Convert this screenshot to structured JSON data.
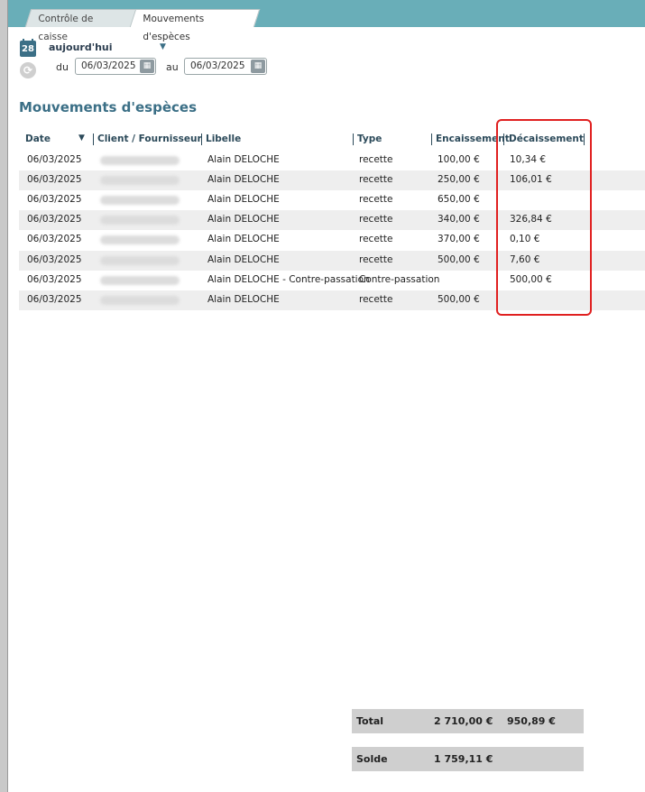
{
  "tabs": [
    {
      "label": "Contrôle de caisse"
    },
    {
      "label": "Mouvements d'espèces"
    }
  ],
  "filter": {
    "calendar_day": "28",
    "period": "aujourd'hui",
    "from_label": "du",
    "from_date": "06/03/2025",
    "to_label": "au",
    "to_date": "06/03/2025"
  },
  "section_title": "Mouvements d'espèces",
  "table": {
    "columns": [
      "Date",
      "Client / Fournisseur",
      "Libelle",
      "Type",
      "Encaissement",
      "Décaissement"
    ],
    "rows": [
      {
        "date": "06/03/2025",
        "libelle": "Alain DELOCHE",
        "type": "recette",
        "encaissement": "100,00 €",
        "decaissement": "10,34 €"
      },
      {
        "date": "06/03/2025",
        "libelle": "Alain DELOCHE",
        "type": "recette",
        "encaissement": "250,00 €",
        "decaissement": "106,01 €"
      },
      {
        "date": "06/03/2025",
        "libelle": "Alain DELOCHE",
        "type": "recette",
        "encaissement": "650,00 €",
        "decaissement": ""
      },
      {
        "date": "06/03/2025",
        "libelle": "Alain DELOCHE",
        "type": "recette",
        "encaissement": "340,00 €",
        "decaissement": "326,84 €"
      },
      {
        "date": "06/03/2025",
        "libelle": "Alain DELOCHE",
        "type": "recette",
        "encaissement": "370,00 €",
        "decaissement": "0,10 €"
      },
      {
        "date": "06/03/2025",
        "libelle": "Alain DELOCHE",
        "type": "recette",
        "encaissement": "500,00 €",
        "decaissement": "7,60 €"
      },
      {
        "date": "06/03/2025",
        "libelle": "Alain DELOCHE - Contre-passation",
        "type": "Contre-passation",
        "encaissement": "",
        "decaissement": "500,00 €"
      },
      {
        "date": "06/03/2025",
        "libelle": "Alain DELOCHE",
        "type": "recette",
        "encaissement": "500,00 €",
        "decaissement": ""
      }
    ]
  },
  "totals": {
    "total_label": "Total",
    "total_encaissement": "2 710,00 €",
    "total_decaissement": "950,89 €",
    "solde_label": "Solde",
    "solde_value": "1 759,11 €"
  },
  "colors": {
    "tabbar": "#69aeb8",
    "title": "#3b6f86",
    "highlight": "#e02020"
  }
}
